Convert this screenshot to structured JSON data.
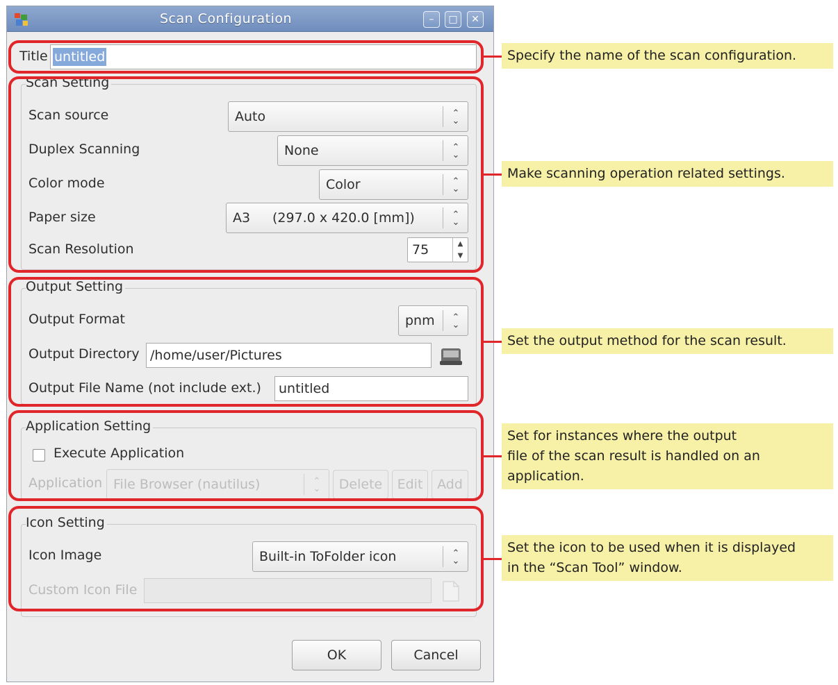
{
  "window": {
    "title": "Scan Configuration",
    "minimize_icon": "minimize-icon",
    "maximize_icon": "maximize-icon",
    "close_icon": "close-icon"
  },
  "title_row": {
    "label": "Title",
    "value": "untitled"
  },
  "scan_setting": {
    "heading": "Scan Setting",
    "scan_source": {
      "label": "Scan source",
      "value": "Auto"
    },
    "duplex": {
      "label": "Duplex Scanning",
      "value": "None"
    },
    "color_mode": {
      "label": "Color mode",
      "value": "Color"
    },
    "paper_size": {
      "label": "Paper size",
      "value": "A3",
      "detail": "(297.0 x 420.0 [mm])"
    },
    "resolution": {
      "label": "Scan Resolution",
      "value": "75"
    }
  },
  "output_setting": {
    "heading": "Output Setting",
    "format": {
      "label": "Output Format",
      "value": "pnm"
    },
    "directory": {
      "label": "Output Directory",
      "value": "/home/user/Pictures"
    },
    "file_name": {
      "label": "Output File Name (not include ext.)",
      "value": "untitled"
    }
  },
  "application_setting": {
    "heading": "Application Setting",
    "execute": {
      "label": "Execute Application",
      "checked": false
    },
    "application": {
      "label": "Application",
      "value": "File Browser (nautilus)"
    },
    "delete_label": "Delete",
    "edit_label": "Edit",
    "add_label": "Add"
  },
  "icon_setting": {
    "heading": "Icon Setting",
    "icon_image": {
      "label": "Icon Image",
      "value": "Built-in ToFolder icon"
    },
    "custom_icon_file": {
      "label": "Custom Icon File",
      "value": ""
    }
  },
  "buttons": {
    "ok": "OK",
    "cancel": "Cancel"
  },
  "callouts": {
    "title": "Specify the name of the scan configuration.",
    "scan": "Make scanning operation related settings.",
    "output": "Set the output method for the scan result.",
    "application": [
      "Set for instances where the output",
      "file of the scan result is handled on an",
      "application."
    ],
    "icon": [
      "Set the icon to be used when it is displayed",
      "in the “Scan Tool” window."
    ]
  },
  "colors": {
    "highlight": "#e0262b",
    "callout_bg": "#f7f0a7",
    "titlebar": "#7b98c5",
    "selection": "#86a9dc"
  }
}
